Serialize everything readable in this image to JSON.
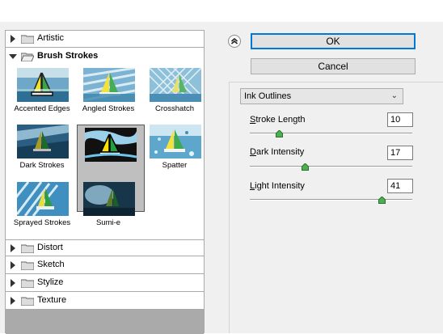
{
  "categories": {
    "artistic": "Artistic",
    "brush_strokes": "Brush Strokes",
    "distort": "Distort",
    "sketch": "Sketch",
    "stylize": "Stylize",
    "texture": "Texture"
  },
  "brush_stroke_filters": [
    {
      "label": "Accented Edges"
    },
    {
      "label": "Angled Strokes"
    },
    {
      "label": "Crosshatch"
    },
    {
      "label": "Dark Strokes"
    },
    {
      "label": "Ink Outlines",
      "selected": true
    },
    {
      "label": "Spatter"
    },
    {
      "label": "Sprayed Strokes"
    },
    {
      "label": "Sumi-e"
    }
  ],
  "buttons": {
    "ok": "OK",
    "cancel": "Cancel"
  },
  "filter_select": {
    "value": "Ink Outlines"
  },
  "settings": {
    "stroke_length": {
      "label_first": "S",
      "label_rest": "troke Length",
      "value": "10",
      "min": 1,
      "max": 50
    },
    "dark_intensity": {
      "label_first": "D",
      "label_rest": "ark Intensity",
      "value": "17",
      "min": 0,
      "max": 50
    },
    "light_intensity": {
      "label_first": "L",
      "label_rest": "ight Intensity",
      "value": "41",
      "min": 0,
      "max": 50
    }
  },
  "colors": {
    "accent": "#0078d7",
    "panel": "#f0f0f0",
    "selected_thumb": "#bfbfbf"
  }
}
